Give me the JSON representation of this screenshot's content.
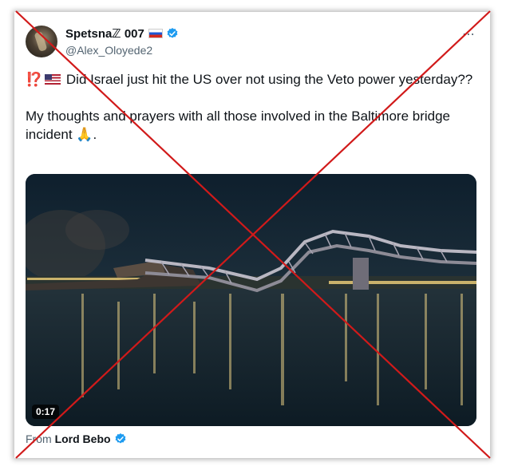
{
  "author": {
    "display_name": "Spetsnaℤ 007",
    "handle": "@Alex_Oloyede2",
    "avatar_icon": "avatar-photo"
  },
  "menu": {
    "label": "⋯"
  },
  "tweet": {
    "line1_prefix": "⁉️",
    "line1_text": "Did Israel just hit the US over not using the Veto power yesterday??",
    "line2_text": "My thoughts and prayers with all those involved in the Baltimore bridge incident",
    "line2_emoji": "🙏",
    "line2_end": "."
  },
  "media": {
    "duration": "0:17",
    "description_icon": "collapsed-bridge-video"
  },
  "attribution": {
    "from_label": "From",
    "source_name": "Lord Bebo"
  },
  "colors": {
    "verified": "#1d9bf0",
    "cross": "#d11a1a",
    "text": "#0f1419",
    "muted": "#536471"
  }
}
